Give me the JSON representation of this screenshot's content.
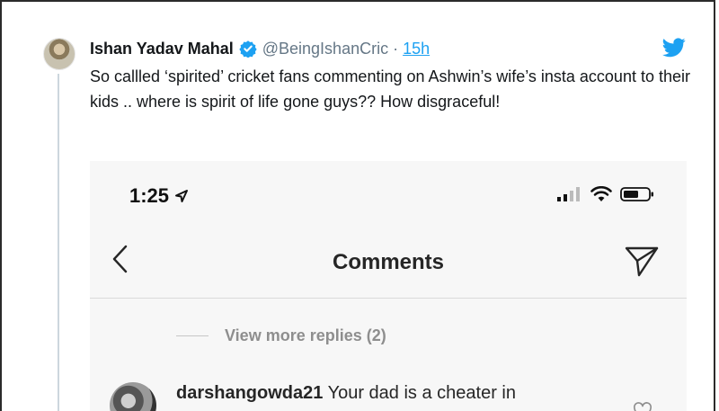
{
  "tweet": {
    "author_name": "Ishan Yadav Mahal",
    "handle": "@BeingIshanCric",
    "separator": "·",
    "time": "15h",
    "text": "So callled ‘spirited’ cricket fans commenting on Ashwin’s wife’s insta account to their kids .. where is spirit of life gone guys?? How disgraceful!"
  },
  "embedded_screenshot": {
    "status_bar": {
      "time": "1:25"
    },
    "header": {
      "title": "Comments"
    },
    "view_replies": "View more replies (2)",
    "comment": {
      "username": "darshangowda21",
      "text": " Your dad is a cheater in"
    }
  },
  "colors": {
    "twitter_blue": "#1da1f2",
    "text_primary": "#14171a",
    "text_secondary": "#657786",
    "instagram_gray": "#8e8e8e"
  },
  "icons": [
    "verified-badge-icon",
    "twitter-bird-icon",
    "location-arrow-icon",
    "signal-icon",
    "wifi-icon",
    "battery-icon",
    "back-arrow-icon",
    "send-icon",
    "heart-icon"
  ]
}
